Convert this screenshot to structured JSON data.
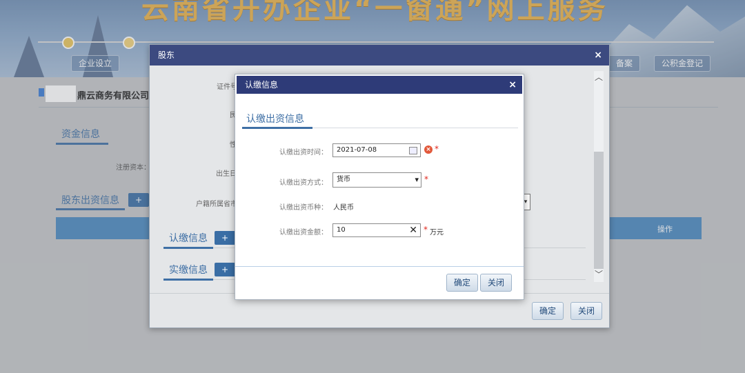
{
  "banner": {
    "title": "云南省开办企业“一窗通”网上服务",
    "steps": [
      "企业设立",
      "备案",
      "公积金登记"
    ]
  },
  "page": {
    "company_name": "鼎云商务有限公司",
    "sections": {
      "capital": "资金信息",
      "registered_capital_label": "注册资本：",
      "shareholder_contrib": "股东出资信息",
      "plus": "+"
    },
    "table_header_action": "操作"
  },
  "shareholder_dialog": {
    "title": "股东",
    "close": "×",
    "labels": [
      "证件号",
      "民",
      "性",
      "出生日",
      "户籍所属省市"
    ],
    "sections": {
      "subscribe": "认缴信息",
      "paid": "实缴信息",
      "plus": "+"
    },
    "buttons": {
      "confirm": "确定",
      "close": "关闭"
    }
  },
  "subscribe_dialog": {
    "title": "认缴信息",
    "close": "×",
    "tab": "认缴出资信息",
    "fields": {
      "time_label": "认缴出资时间：",
      "time_value": "2021-07-08",
      "method_label": "认缴出资方式：",
      "method_value": "货币",
      "currency_label": "认缴出资币种：",
      "currency_value": "人民币",
      "amount_label": "认缴出资金额：",
      "amount_value": "10",
      "amount_unit": "万元",
      "required_mark": "*"
    },
    "buttons": {
      "confirm": "确定",
      "close": "关闭"
    }
  },
  "colors": {
    "dialog_header": "#2e3b78",
    "accent_blue": "#3e6fa5",
    "required_red": "#e0261c"
  }
}
